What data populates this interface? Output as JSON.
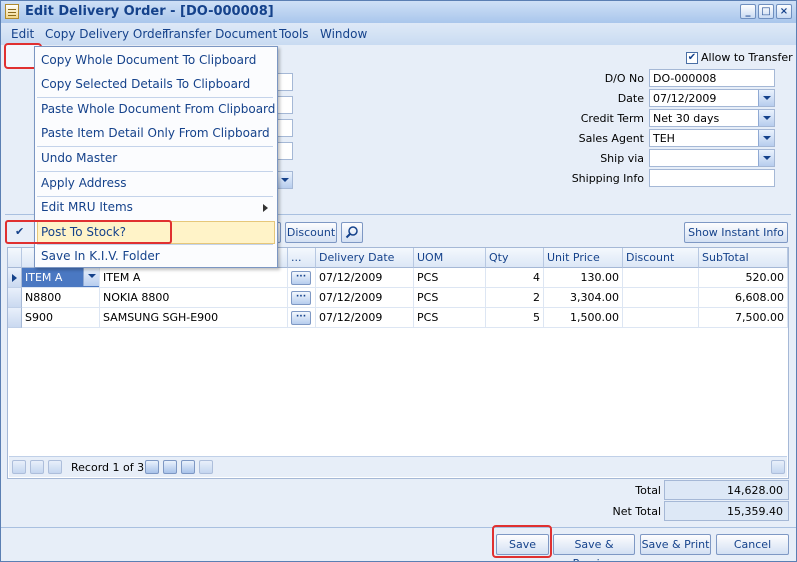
{
  "window": {
    "title": "Edit Delivery Order - [DO-000008]"
  },
  "menubar": [
    "Edit",
    "Copy Delivery Order",
    "Transfer Document",
    "Tools",
    "Window"
  ],
  "edit_menu": {
    "items": [
      "Copy Whole Document To Clipboard",
      "Copy Selected Details To Clipboard",
      "Paste Whole Document From Clipboard",
      "Paste Item Detail Only From Clipboard",
      "Undo Master",
      "Apply Address",
      "Edit MRU Items",
      "Post To Stock?",
      "Save In K.I.V. Folder"
    ],
    "checked": "✔"
  },
  "header": {
    "allow_transfer_label": "Allow to Transfer",
    "allow_transfer_check": "✔",
    "do_no_label": "D/O No",
    "do_no": "DO-000008",
    "date_label": "Date",
    "date": "07/12/2009",
    "credit_term_label": "Credit Term",
    "credit_term": "Net 30 days",
    "sales_agent_label": "Sales Agent",
    "sales_agent": "TEH",
    "ship_via_label": "Ship via",
    "ship_via": "",
    "shipping_info_label": "Shipping Info",
    "shipping_info": ""
  },
  "toolbar": {
    "discount": "Discount",
    "show_instant_info": "Show Instant Info"
  },
  "grid": {
    "columns": [
      "...",
      "Delivery Date",
      "UOM",
      "Qty",
      "Unit Price",
      "Discount",
      "SubTotal"
    ],
    "rows": [
      {
        "code": "ITEM A",
        "desc": "ITEM A",
        "ellipsis": "···",
        "date": "07/12/2009",
        "uom": "PCS",
        "qty": "4",
        "price": "130.00",
        "discount": "",
        "subtotal": "520.00"
      },
      {
        "code": "N8800",
        "desc": "NOKIA 8800",
        "ellipsis": "···",
        "date": "07/12/2009",
        "uom": "PCS",
        "qty": "2",
        "price": "3,304.00",
        "discount": "",
        "subtotal": "6,608.00"
      },
      {
        "code": "S900",
        "desc": "SAMSUNG SGH-E900",
        "ellipsis": "···",
        "date": "07/12/2009",
        "uom": "PCS",
        "qty": "5",
        "price": "1,500.00",
        "discount": "",
        "subtotal": "7,500.00"
      }
    ],
    "record_text": "Record 1 of 3"
  },
  "totals": {
    "total_label": "Total",
    "total": "14,628.00",
    "net_total_label": "Net Total",
    "net_total": "15,359.40"
  },
  "footer": {
    "save": "Save",
    "save_preview": "Save & Preview",
    "save_print": "Save & Print",
    "cancel": "Cancel"
  }
}
